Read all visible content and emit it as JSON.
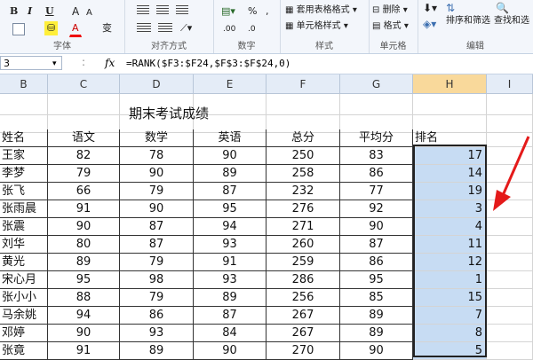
{
  "ribbon": {
    "font_group": "字体",
    "align_group": "对齐方式",
    "number_group": "数字",
    "styles_group": "样式",
    "cells_group": "单元格",
    "edit_group": "编辑",
    "bold": "B",
    "italic": "I",
    "underline": "U",
    "grow_font": "A",
    "shrink_font": "A",
    "font_color": "A",
    "wen": "变",
    "percent": "%",
    "comma": ",",
    "inc_dec": ".00",
    "dec_dec": ".0",
    "table_format": "套用表格格式",
    "cell_style": "单元格样式",
    "delete": "删除",
    "format": "格式",
    "sort_filter": "排序和筛选",
    "find_select": "查找和选"
  },
  "formula_bar": {
    "name_box": "3",
    "fx": "fx",
    "formula": "=RANK($F3:$F24,$F$3:$F$24,0)"
  },
  "columns": [
    "B",
    "C",
    "D",
    "E",
    "F",
    "G",
    "H",
    "I"
  ],
  "sheet": {
    "title": "期末考试成绩",
    "headers": [
      "姓名",
      "语文",
      "数学",
      "英语",
      "总分",
      "平均分",
      "排名"
    ],
    "rows": [
      [
        "王家",
        "82",
        "78",
        "90",
        "250",
        "83",
        "17"
      ],
      [
        "李梦",
        "79",
        "90",
        "89",
        "258",
        "86",
        "14"
      ],
      [
        "张飞",
        "66",
        "79",
        "87",
        "232",
        "77",
        "19"
      ],
      [
        "张雨晨",
        "91",
        "90",
        "95",
        "276",
        "92",
        "3"
      ],
      [
        "张震",
        "90",
        "87",
        "94",
        "271",
        "90",
        "4"
      ],
      [
        "刘华",
        "80",
        "87",
        "93",
        "260",
        "87",
        "11"
      ],
      [
        "黄光",
        "89",
        "79",
        "91",
        "259",
        "86",
        "12"
      ],
      [
        "宋心月",
        "95",
        "98",
        "93",
        "286",
        "95",
        "1"
      ],
      [
        "张小小",
        "88",
        "79",
        "89",
        "256",
        "85",
        "15"
      ],
      [
        "马余姚",
        "94",
        "86",
        "87",
        "267",
        "89",
        "7"
      ],
      [
        "邓婷",
        "90",
        "93",
        "84",
        "267",
        "89",
        "8"
      ],
      [
        "张竟",
        "91",
        "89",
        "90",
        "270",
        "90",
        "5"
      ]
    ]
  }
}
